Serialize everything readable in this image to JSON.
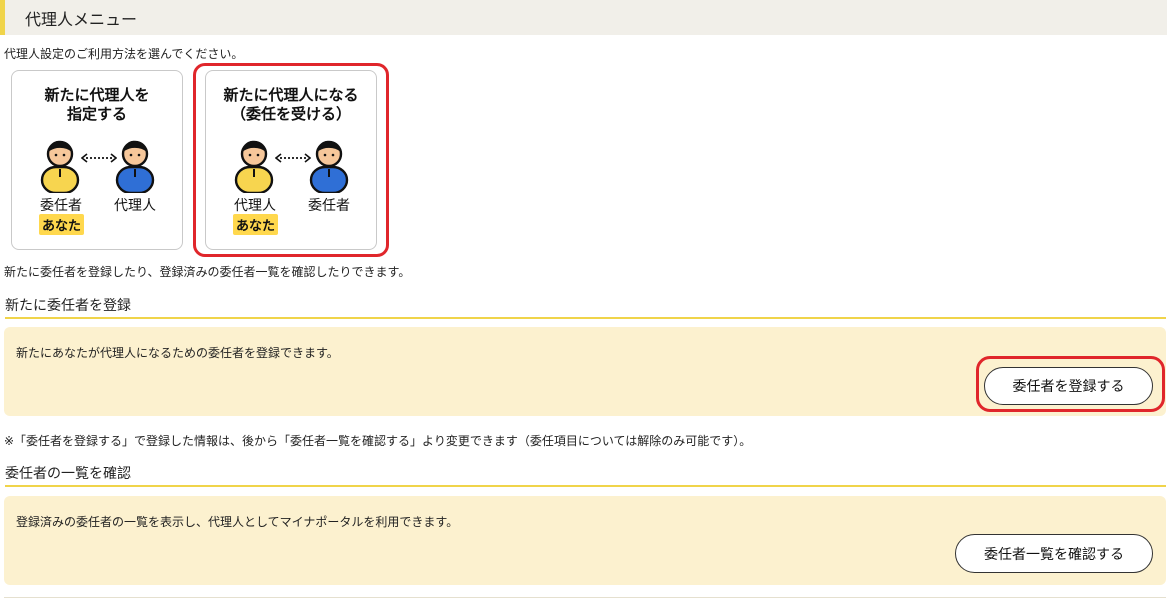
{
  "header": {
    "title": "代理人メニュー"
  },
  "intro": "代理人設定のご利用方法を選んでください。",
  "cards": [
    {
      "title_line1": "新たに代理人を",
      "title_line2": "指定する",
      "left_role": "委任者",
      "right_role": "代理人",
      "you_badge": "あなた",
      "icons": [
        "person-yellow-icon",
        "dotted-arrow-icon",
        "person-blue-icon"
      ]
    },
    {
      "title_line1": "新たに代理人になる",
      "title_line2": "（委任を受ける）",
      "left_role": "代理人",
      "right_role": "委任者",
      "you_badge": "あなた",
      "icons": [
        "person-yellow-icon",
        "dotted-arrow-icon",
        "person-blue-icon"
      ]
    }
  ],
  "description": "新たに委任者を登録したり、登録済みの委任者一覧を確認したりできます。",
  "sections": [
    {
      "title": "新たに委任者を登録",
      "text": "新たにあなたが代理人になるための委任者を登録できます。",
      "button_label": "委任者を登録する"
    },
    {
      "title": "委任者の一覧を確認",
      "text": "登録済みの委任者の一覧を表示し、代理人としてマイナポータルを利用できます。",
      "button_label": "委任者一覧を確認する"
    }
  ],
  "note": "※「委任者を登録する」で登録した情報は、後から「委任者一覧を確認する」より変更できます（委任項目については解除のみ可能です）。",
  "colors": {
    "accent_yellow": "#f0d44a",
    "panel_bg": "#fcf1cf",
    "highlight_red": "#e0262b",
    "person_yellow": "#f7d54f",
    "person_blue": "#2f6fd6"
  }
}
